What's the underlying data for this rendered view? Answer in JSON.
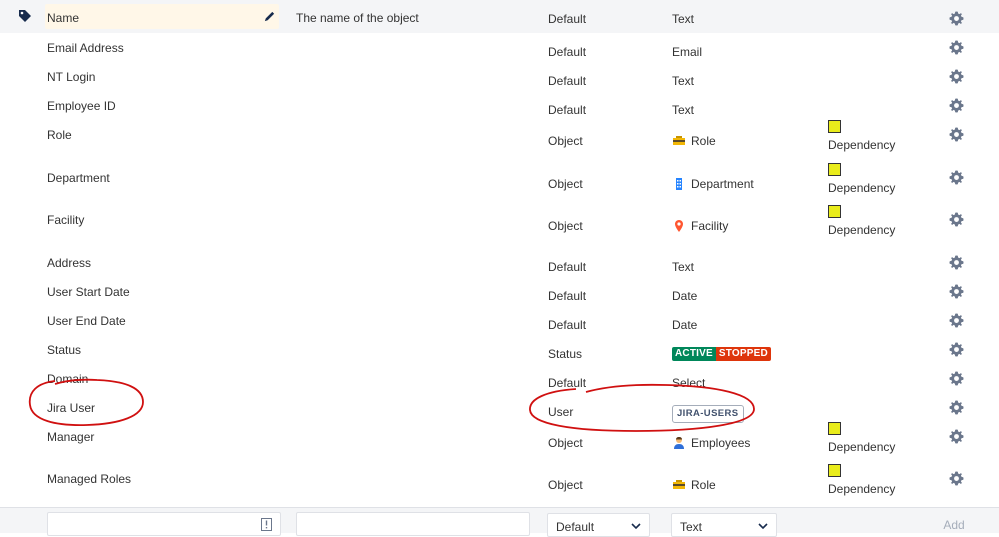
{
  "rows": [
    {
      "name": "Name",
      "description": "The name of the object",
      "kind": "Default",
      "type": "Text",
      "dependency": ""
    },
    {
      "name": "Email Address",
      "kind": "Default",
      "type": "Email"
    },
    {
      "name": "NT Login",
      "kind": "Default",
      "type": "Text"
    },
    {
      "name": "Employee ID",
      "kind": "Default",
      "type": "Text"
    },
    {
      "name": "Role",
      "kind": "Object",
      "type": "Role",
      "dependency": "Dependency"
    },
    {
      "name": "Department",
      "kind": "Object",
      "type": "Department",
      "dependency": "Dependency"
    },
    {
      "name": "Facility",
      "kind": "Object",
      "type": "Facility",
      "dependency": "Dependency"
    },
    {
      "name": "Address",
      "kind": "Default",
      "type": "Text"
    },
    {
      "name": "User Start Date",
      "kind": "Default",
      "type": "Date"
    },
    {
      "name": "User End Date",
      "kind": "Default",
      "type": "Date"
    },
    {
      "name": "Status",
      "kind": "Status",
      "status_active": "ACTIVE",
      "status_stopped": "STOPPED"
    },
    {
      "name": "Domain",
      "kind": "Default",
      "type": "Select"
    },
    {
      "name": "Jira User",
      "kind": "User",
      "group": "JIRA-USERS"
    },
    {
      "name": "Manager",
      "kind": "Object",
      "type": "Employees",
      "dependency": "Dependency"
    },
    {
      "name": "Managed Roles",
      "kind": "Object",
      "type": "Role",
      "dependency": "Dependency"
    }
  ],
  "add_bar": {
    "kind_select": "Default",
    "type_select": "Text",
    "add_label": "Add"
  },
  "colors": {
    "dependency_box": "#e9ec1b",
    "active": "#00875a",
    "stopped": "#de350b",
    "annotation": "#d01010"
  }
}
